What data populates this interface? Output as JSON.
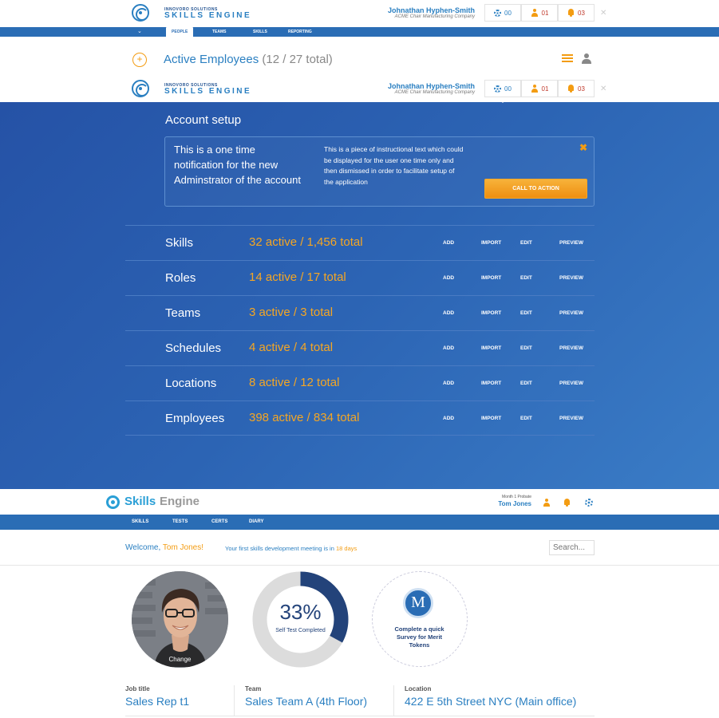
{
  "header": {
    "logo_small": "INNOVORO SOLUTIONS",
    "logo_big": "SKILLS ENGINE",
    "user_name": "Johnathan Hyphen-Smith",
    "company": "ACME Chair Manufacturing Company",
    "counts": {
      "settings": "00",
      "people": "01",
      "alerts": "03"
    },
    "close": "✕"
  },
  "nav": {
    "chevron": "⌄",
    "items": [
      "PEOPLE",
      "TEAMS",
      "SKILLS",
      "REPORTING"
    ]
  },
  "employees": {
    "plus": "+",
    "title": "Active Employees",
    "count": "(12 / 27 total)"
  },
  "setup": {
    "title": "Account setup",
    "notification": {
      "heading": "This is a one time notification for the new Adminstrator of the account",
      "body": "This is a piece of instructional text which could be displayed for the user one time only and then dismissed in order to facilitate setup of the application",
      "cta": "CALL TO ACTION",
      "close": "✖"
    },
    "actions": {
      "add": "ADD",
      "import": "IMPORT",
      "edit": "EDIT",
      "preview": "PREVIEW"
    },
    "rows": [
      {
        "label": "Skills",
        "count": "32 active  / 1,456 total"
      },
      {
        "label": "Roles",
        "count": "14 active / 17 total"
      },
      {
        "label": "Teams",
        "count": "3 active / 3 total"
      },
      {
        "label": "Schedules",
        "count": "4 active / 4 total"
      },
      {
        "label": "Locations",
        "count": "8 active / 12 total"
      },
      {
        "label": "Employees",
        "count": "398 active / 834 total"
      }
    ]
  },
  "app": {
    "logo_skills": "Skills",
    "logo_engine": "Engine",
    "probate": "Month 1 Probate",
    "user": "Tom Jones",
    "nav": [
      "SKILLS",
      "TESTS",
      "CERTS",
      "DIARY"
    ]
  },
  "welcome": {
    "prefix": "Welcome,",
    "name": "Tom Jones!",
    "meeting_prefix": "Your first skills development meeting is in",
    "meeting_days": "18 days",
    "search_placeholder": "Search..."
  },
  "stats": {
    "change_label": "Change",
    "progress_percent": 33,
    "progress_text": "33%",
    "progress_label": "Self Test Completed",
    "badge_letter": "M",
    "survey_label": "Complete a quick Survey for Merit Tokens"
  },
  "profile": {
    "job_title_label": "Job title",
    "job_title": "Sales Rep t1",
    "team_label": "Team",
    "team": "Sales Team A (4th Floor)",
    "location_label": "Location",
    "location": "422 E 5th Street NYC (Main office)"
  },
  "colors": {
    "brand_blue": "#2a7fc1",
    "nav_blue": "#2a6db5",
    "accent_orange": "#f39c12",
    "panel_blue": "#2c64b4",
    "progress_navy": "#23437a"
  }
}
